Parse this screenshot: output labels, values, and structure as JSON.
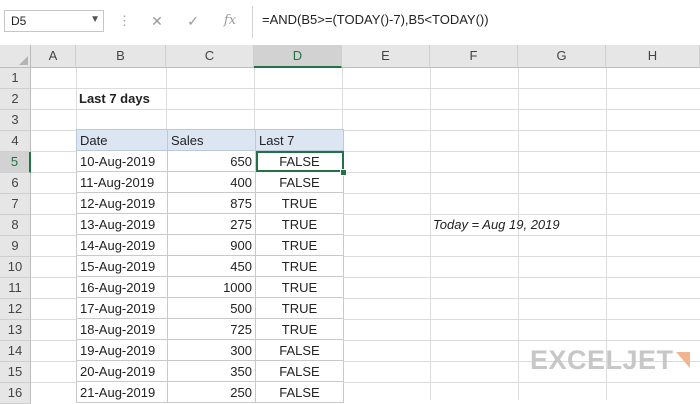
{
  "formula_bar": {
    "name_box": "D5",
    "name_box_arrow_icon": "chevron-down-icon",
    "cancel_icon": "close-icon",
    "enter_icon": "check-icon",
    "fx_label": "fx",
    "formula": "=AND(B5>=(TODAY()-7),B5<TODAY())"
  },
  "columns": [
    "A",
    "B",
    "C",
    "D",
    "E",
    "F",
    "G",
    "H"
  ],
  "selected_column": "D",
  "rows": [
    "1",
    "2",
    "3",
    "4",
    "5",
    "6",
    "7",
    "8",
    "9",
    "10",
    "11",
    "12",
    "13",
    "14",
    "15",
    "16"
  ],
  "selected_row": "5",
  "sheet": {
    "title": "Last 7 days",
    "headers": {
      "date": "Date",
      "sales": "Sales",
      "last7": "Last 7"
    },
    "records": [
      {
        "date": "10-Aug-2019",
        "sales": "650",
        "last7": "FALSE"
      },
      {
        "date": "11-Aug-2019",
        "sales": "400",
        "last7": "FALSE"
      },
      {
        "date": "12-Aug-2019",
        "sales": "875",
        "last7": "TRUE"
      },
      {
        "date": "13-Aug-2019",
        "sales": "275",
        "last7": "TRUE"
      },
      {
        "date": "14-Aug-2019",
        "sales": "900",
        "last7": "TRUE"
      },
      {
        "date": "15-Aug-2019",
        "sales": "450",
        "last7": "TRUE"
      },
      {
        "date": "16-Aug-2019",
        "sales": "1000",
        "last7": "TRUE"
      },
      {
        "date": "17-Aug-2019",
        "sales": "500",
        "last7": "TRUE"
      },
      {
        "date": "18-Aug-2019",
        "sales": "725",
        "last7": "TRUE"
      },
      {
        "date": "19-Aug-2019",
        "sales": "300",
        "last7": "FALSE"
      },
      {
        "date": "20-Aug-2019",
        "sales": "350",
        "last7": "FALSE"
      },
      {
        "date": "21-Aug-2019",
        "sales": "250",
        "last7": "FALSE"
      }
    ],
    "note": "Today = Aug 19, 2019"
  },
  "logo": {
    "text": "EXCELJET"
  },
  "colors": {
    "selection_green": "#217346",
    "header_fill": "#dce6f2",
    "logo_gray": "#c7c7c7",
    "logo_orange": "#f2b48f"
  }
}
